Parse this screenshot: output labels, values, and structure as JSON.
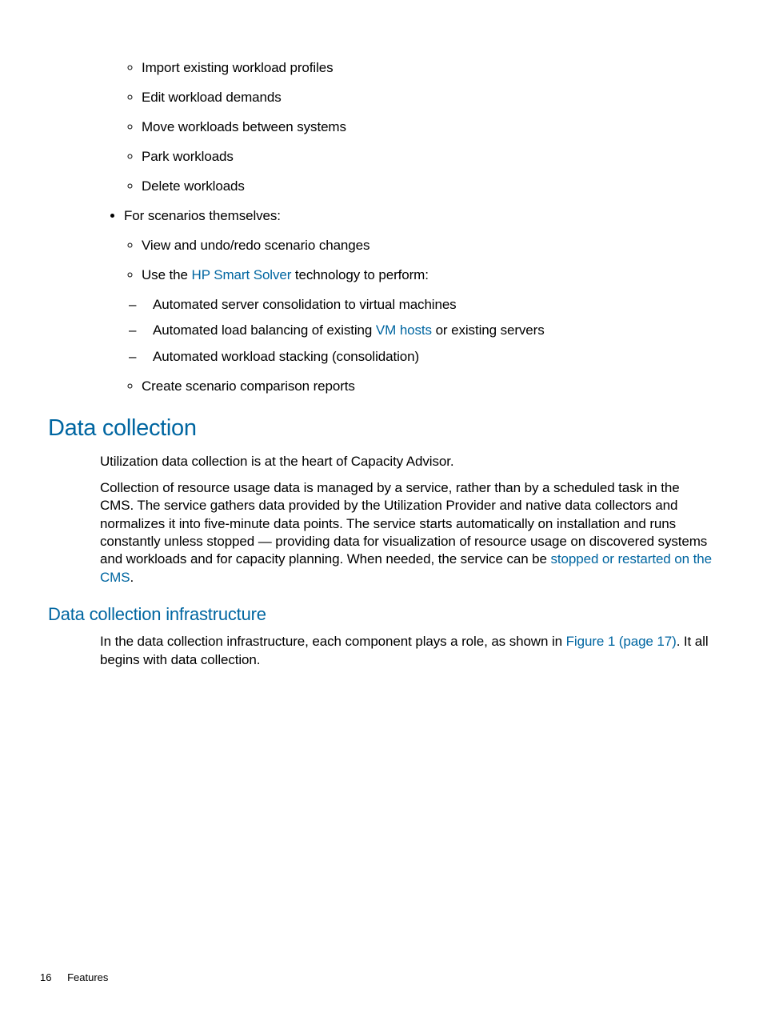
{
  "lists": {
    "sub1": [
      "Import existing workload profiles",
      "Edit workload demands",
      "Move workloads between systems",
      "Park workloads",
      "Delete workloads"
    ],
    "top_item": "For scenarios themselves:",
    "sub2_item1": "View and undo/redo scenario changes",
    "sub2_item2_pre": "Use the ",
    "sub2_item2_link": "HP Smart Solver",
    "sub2_item2_post": " technology to perform:",
    "dash_item1": "Automated server consolidation to virtual machines",
    "dash_item2_pre": "Automated load balancing of existing ",
    "dash_item2_link": "VM hosts",
    "dash_item2_post": " or existing servers",
    "dash_item3": "Automated workload stacking (consolidation)",
    "sub2_item3": "Create scenario comparison reports"
  },
  "section1": {
    "heading": "Data collection",
    "p1": "Utilization data collection is at the heart of Capacity Advisor.",
    "p2_pre": "Collection of resource usage data is managed by a service, rather than by a scheduled task in the CMS. The service gathers data provided by the Utilization Provider and native data collectors and normalizes it into five-minute data points. The service starts automatically on installation and runs constantly unless stopped — providing data for visualization of resource usage on discovered systems and workloads and for capacity planning. When needed, the service can be ",
    "p2_link": "stopped or restarted on the CMS",
    "p2_post": "."
  },
  "section2": {
    "heading": "Data collection infrastructure",
    "p1_pre": "In the data collection infrastructure, each component plays a role, as shown in ",
    "p1_link": "Figure 1 (page 17)",
    "p1_post": ". It all begins with data collection."
  },
  "footer": {
    "page": "16",
    "label": "Features"
  }
}
